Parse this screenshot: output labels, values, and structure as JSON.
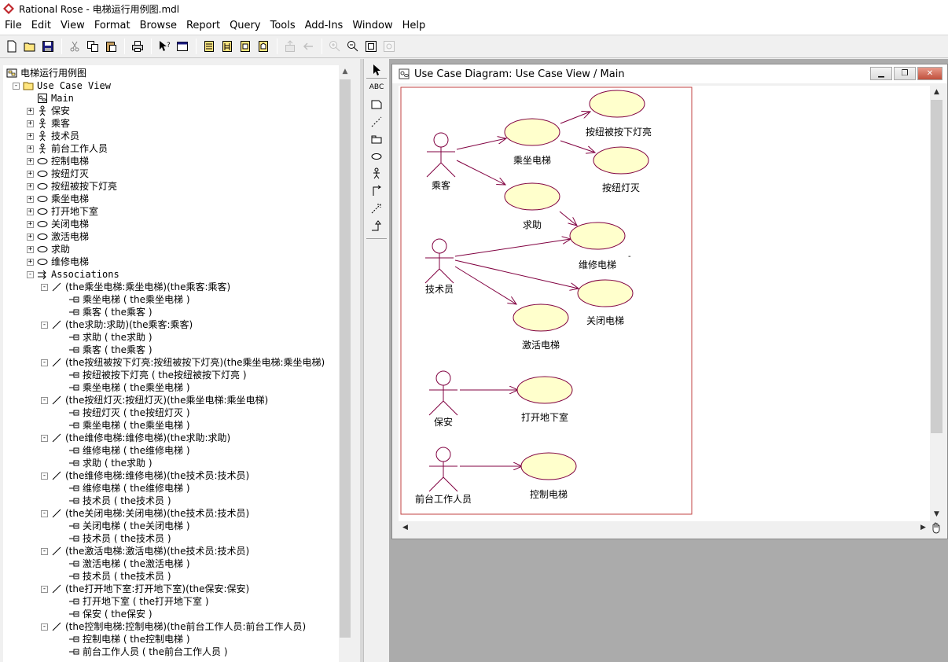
{
  "app": {
    "title": "Rational Rose - 电梯运行用例图.mdl"
  },
  "menu": [
    "File",
    "Edit",
    "View",
    "Format",
    "Browse",
    "Report",
    "Query",
    "Tools",
    "Add-Ins",
    "Window",
    "Help"
  ],
  "toolbar": {
    "buttons": [
      "new-icon",
      "open-icon",
      "save-icon",
      "cut-icon",
      "copy-icon",
      "paste-icon",
      "print-icon",
      "context-help-icon",
      "view-doc-icon",
      "browse-class-icon",
      "browse-interaction-icon",
      "browse-component-icon",
      "browse-deployment-icon",
      "browse-parent-icon",
      "browse-previous-icon",
      "zoom-in-icon",
      "zoom-out-icon",
      "fit-window-icon",
      "undo-fit-icon"
    ]
  },
  "browser": {
    "root": "电梯运行用例图",
    "rows": [
      {
        "text": "电梯运行用例图",
        "depth": 0,
        "icon": "model-icon",
        "exp": ""
      },
      {
        "text": "Use Case View",
        "depth": 1,
        "icon": "folder-icon",
        "exp": "-",
        "mono": true
      },
      {
        "text": "Main",
        "depth": 2,
        "icon": "diagram-icon",
        "exp": "",
        "mono": true
      },
      {
        "text": "保安",
        "depth": 2,
        "icon": "actor-icon",
        "exp": "+"
      },
      {
        "text": "乘客",
        "depth": 2,
        "icon": "actor-icon",
        "exp": "+"
      },
      {
        "text": "技术员",
        "depth": 2,
        "icon": "actor-icon",
        "exp": "+"
      },
      {
        "text": "前台工作人员",
        "depth": 2,
        "icon": "actor-icon",
        "exp": "+"
      },
      {
        "text": "控制电梯",
        "depth": 2,
        "icon": "usecase-icon",
        "exp": "+"
      },
      {
        "text": "按纽灯灭",
        "depth": 2,
        "icon": "usecase-icon",
        "exp": "+"
      },
      {
        "text": "按纽被按下灯亮",
        "depth": 2,
        "icon": "usecase-icon",
        "exp": "+"
      },
      {
        "text": "乘坐电梯",
        "depth": 2,
        "icon": "usecase-icon",
        "exp": "+"
      },
      {
        "text": "打开地下室",
        "depth": 2,
        "icon": "usecase-icon",
        "exp": "+"
      },
      {
        "text": "关闭电梯",
        "depth": 2,
        "icon": "usecase-icon",
        "exp": "+"
      },
      {
        "text": "激活电梯",
        "depth": 2,
        "icon": "usecase-icon",
        "exp": "+"
      },
      {
        "text": "求助",
        "depth": 2,
        "icon": "usecase-icon",
        "exp": "+"
      },
      {
        "text": "维修电梯",
        "depth": 2,
        "icon": "usecase-icon",
        "exp": "+"
      },
      {
        "text": "Associations",
        "depth": 2,
        "icon": "associations-icon",
        "exp": "-",
        "mono": true
      },
      {
        "text": "(the乘坐电梯:乘坐电梯)(the乘客:乘客)",
        "depth": 3,
        "icon": "association-icon",
        "exp": "-"
      },
      {
        "text": "乘坐电梯 ( the乘坐电梯 )",
        "depth": 4,
        "icon": "role-icon",
        "exp": ""
      },
      {
        "text": "乘客 ( the乘客 )",
        "depth": 4,
        "icon": "role-icon",
        "exp": ""
      },
      {
        "text": "(the求助:求助)(the乘客:乘客)",
        "depth": 3,
        "icon": "association-icon",
        "exp": "-"
      },
      {
        "text": "求助 ( the求助 )",
        "depth": 4,
        "icon": "role-icon",
        "exp": ""
      },
      {
        "text": "乘客 ( the乘客 )",
        "depth": 4,
        "icon": "role-icon",
        "exp": ""
      },
      {
        "text": "(the按纽被按下灯亮:按纽被按下灯亮)(the乘坐电梯:乘坐电梯)",
        "depth": 3,
        "icon": "association-icon",
        "exp": "-"
      },
      {
        "text": "按纽被按下灯亮 ( the按纽被按下灯亮 )",
        "depth": 4,
        "icon": "role-icon",
        "exp": ""
      },
      {
        "text": "乘坐电梯 ( the乘坐电梯 )",
        "depth": 4,
        "icon": "role-icon",
        "exp": ""
      },
      {
        "text": "(the按纽灯灭:按纽灯灭)(the乘坐电梯:乘坐电梯)",
        "depth": 3,
        "icon": "association-icon",
        "exp": "-"
      },
      {
        "text": "按纽灯灭 ( the按纽灯灭 )",
        "depth": 4,
        "icon": "role-icon",
        "exp": ""
      },
      {
        "text": "乘坐电梯 ( the乘坐电梯 )",
        "depth": 4,
        "icon": "role-icon",
        "exp": ""
      },
      {
        "text": "(the维修电梯:维修电梯)(the求助:求助)",
        "depth": 3,
        "icon": "association-icon",
        "exp": "-"
      },
      {
        "text": "维修电梯 ( the维修电梯 )",
        "depth": 4,
        "icon": "role-icon",
        "exp": ""
      },
      {
        "text": "求助 ( the求助 )",
        "depth": 4,
        "icon": "role-icon",
        "exp": ""
      },
      {
        "text": "(the维修电梯:维修电梯)(the技术员:技术员)",
        "depth": 3,
        "icon": "association-icon",
        "exp": "-"
      },
      {
        "text": "维修电梯 ( the维修电梯 )",
        "depth": 4,
        "icon": "role-icon",
        "exp": ""
      },
      {
        "text": "技术员 ( the技术员 )",
        "depth": 4,
        "icon": "role-icon",
        "exp": ""
      },
      {
        "text": "(the关闭电梯:关闭电梯)(the技术员:技术员)",
        "depth": 3,
        "icon": "association-icon",
        "exp": "-"
      },
      {
        "text": "关闭电梯 ( the关闭电梯 )",
        "depth": 4,
        "icon": "role-icon",
        "exp": ""
      },
      {
        "text": "技术员 ( the技术员 )",
        "depth": 4,
        "icon": "role-icon",
        "exp": ""
      },
      {
        "text": "(the激活电梯:激活电梯)(the技术员:技术员)",
        "depth": 3,
        "icon": "association-icon",
        "exp": "-"
      },
      {
        "text": "激活电梯 ( the激活电梯 )",
        "depth": 4,
        "icon": "role-icon",
        "exp": ""
      },
      {
        "text": "技术员 ( the技术员 )",
        "depth": 4,
        "icon": "role-icon",
        "exp": ""
      },
      {
        "text": "(the打开地下室:打开地下室)(the保安:保安)",
        "depth": 3,
        "icon": "association-icon",
        "exp": "-"
      },
      {
        "text": "打开地下室 ( the打开地下室 )",
        "depth": 4,
        "icon": "role-icon",
        "exp": ""
      },
      {
        "text": "保安 ( the保安 )",
        "depth": 4,
        "icon": "role-icon",
        "exp": ""
      },
      {
        "text": "(the控制电梯:控制电梯)(the前台工作人员:前台工作人员)",
        "depth": 3,
        "icon": "association-icon",
        "exp": "-"
      },
      {
        "text": "控制电梯 ( the控制电梯 )",
        "depth": 4,
        "icon": "role-icon",
        "exp": ""
      },
      {
        "text": "前台工作人员 ( the前台工作人员 )",
        "depth": 4,
        "icon": "role-icon",
        "exp": ""
      }
    ]
  },
  "palette": [
    "select-tool-icon",
    "text-tool-icon",
    "note-tool-icon",
    "anchor-tool-icon",
    "package-tool-icon",
    "usecase-tool-icon",
    "actor-tool-icon",
    "association-tool-icon",
    "dependency-tool-icon",
    "generalization-tool-icon"
  ],
  "palette_text_label": "ABC",
  "diagram": {
    "window_title": "Use Case Diagram: Use Case View / Main",
    "actors": [
      "乘客",
      "技术员",
      "保安",
      "前台工作人员"
    ],
    "use_cases": [
      "按纽被按下灯亮",
      "乘坐电梯",
      "按纽灯灭",
      "求助",
      "维修电梯",
      "关闭电梯",
      "激活电梯",
      "打开地下室",
      "控制电梯"
    ],
    "colors": {
      "usecase_fill": "#ffffcc",
      "line": "#800040",
      "boundary": "#c04040"
    }
  }
}
